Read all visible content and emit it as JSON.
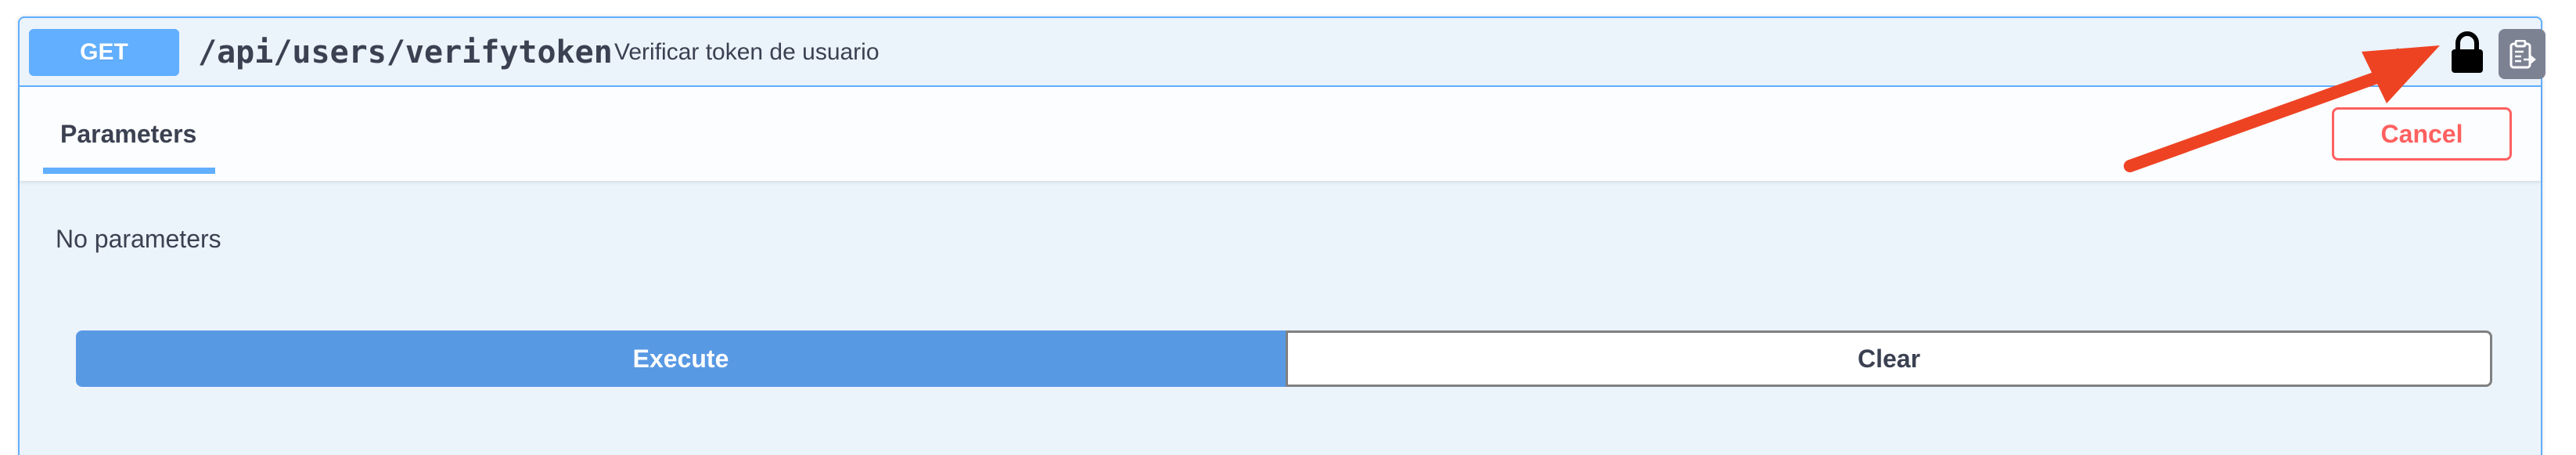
{
  "operation": {
    "method": "GET",
    "path": "/api/users/verifytoken",
    "description": "Verificar token de usuario",
    "colors": {
      "get_accent": "#61affe",
      "background": "#ebf3fb",
      "cancel": "#ff6060",
      "execute": "#4990e2"
    },
    "icons": {
      "collapse": "chevron-up-icon",
      "auth": "lock-icon",
      "copy": "clipboard-copy-icon"
    }
  },
  "tabs": [
    {
      "label": "Parameters",
      "active": true
    }
  ],
  "actions": {
    "cancel_label": "Cancel",
    "execute_label": "Execute",
    "clear_label": "Clear"
  },
  "parameters": {
    "empty_message": "No parameters"
  },
  "annotation": {
    "type": "arrow",
    "color": "#ee4323",
    "points_to": "lock-icon"
  }
}
